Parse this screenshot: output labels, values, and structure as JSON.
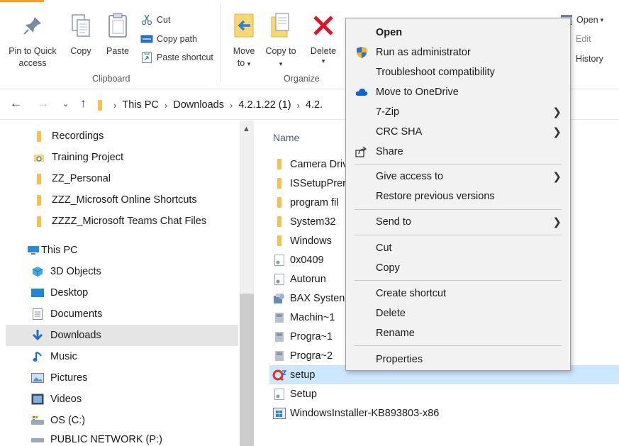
{
  "ribbon": {
    "clipboard_group": "Clipboard",
    "organize_group": "Organize",
    "pin_label": "Pin to Quick access",
    "copy_label": "Copy",
    "paste_label": "Paste",
    "cut_label": "Cut",
    "copy_path_label": "Copy path",
    "paste_shortcut_label": "Paste shortcut",
    "move_to_label": "Move to",
    "copy_to_label": "Copy to",
    "delete_label": "Delete",
    "open_label": "Open",
    "edit_label": "Edit",
    "history_label": "History"
  },
  "address": {
    "crumbs": [
      "This PC",
      "Downloads",
      "4.2.1.22 (1)",
      "4.2."
    ]
  },
  "nav": {
    "items": [
      {
        "label": "Recordings",
        "icon": "folder-icon"
      },
      {
        "label": "Training Project",
        "icon": "shared-folder-icon"
      },
      {
        "label": "ZZ_Personal",
        "icon": "folder-icon"
      },
      {
        "label": "ZZZ_Microsoft Online Shortcuts",
        "icon": "folder-icon"
      },
      {
        "label": "ZZZZ_Microsoft Teams Chat Files",
        "icon": "folder-icon"
      },
      {
        "label": "This PC",
        "icon": "this-pc-icon"
      },
      {
        "label": "3D Objects",
        "icon": "3d-objects-icon"
      },
      {
        "label": "Desktop",
        "icon": "desktop-icon"
      },
      {
        "label": "Documents",
        "icon": "documents-icon"
      },
      {
        "label": "Downloads",
        "icon": "downloads-icon"
      },
      {
        "label": "Music",
        "icon": "music-icon"
      },
      {
        "label": "Pictures",
        "icon": "pictures-icon"
      },
      {
        "label": "Videos",
        "icon": "videos-icon"
      },
      {
        "label": "OS (C:)",
        "icon": "drive-icon"
      },
      {
        "label": "PUBLIC NETWORK (P:)",
        "icon": "network-drive-icon"
      }
    ]
  },
  "files": {
    "header": "Name",
    "rows": [
      {
        "name": "Camera Driv",
        "icon": "folder-icon"
      },
      {
        "name": "ISSetupPrer",
        "icon": "folder-icon"
      },
      {
        "name": "program fil",
        "icon": "folder-icon"
      },
      {
        "name": "System32",
        "icon": "folder-icon"
      },
      {
        "name": "Windows",
        "icon": "folder-icon"
      },
      {
        "name": "0x0409",
        "icon": "settings-file-icon"
      },
      {
        "name": "Autorun",
        "icon": "settings-file-icon"
      },
      {
        "name": "BAX Systen",
        "icon": "installer-icon"
      },
      {
        "name": "Machin~1",
        "icon": "file-icon"
      },
      {
        "name": "Progra~1",
        "icon": "file-icon"
      },
      {
        "name": "Progra~2",
        "icon": "file-icon"
      },
      {
        "name": "setup",
        "icon": "setup-app-icon"
      },
      {
        "name": "Setup",
        "icon": "settings-file-icon"
      },
      {
        "name": "WindowsInstaller-KB893803-x86",
        "icon": "windows-installer-icon"
      }
    ]
  },
  "context_menu": {
    "open": "Open",
    "run_as_admin": "Run as administrator",
    "troubleshoot": "Troubleshoot compatibility",
    "onedrive": "Move to OneDrive",
    "zip": "7-Zip",
    "crc": "CRC SHA",
    "share": "Share",
    "give_access": "Give access to",
    "restore": "Restore previous versions",
    "send_to": "Send to",
    "cut": "Cut",
    "copy": "Copy",
    "create_shortcut": "Create shortcut",
    "delete": "Delete",
    "rename": "Rename",
    "properties": "Properties"
  },
  "colors": {
    "selection": "#cce8ff",
    "nav_selected": "#e5e5e5",
    "menu_bg": "#f2f2f2",
    "delete_red": "#e81123",
    "onedrive_blue": "#0a64d6"
  }
}
